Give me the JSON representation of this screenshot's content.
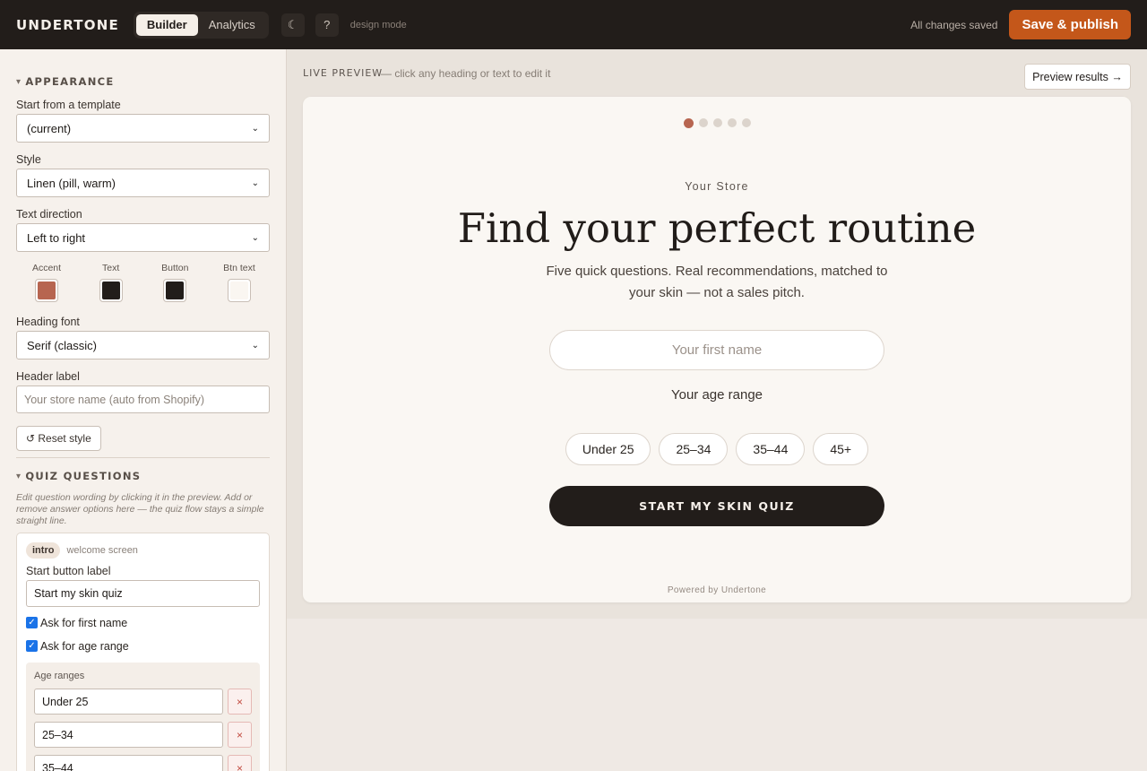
{
  "topbar": {
    "brand": "UNDERTONE",
    "tabs": [
      {
        "label": "Builder",
        "active": true
      },
      {
        "label": "Analytics",
        "active": false
      }
    ],
    "dark_mode_icon": "moon-icon",
    "help_label": "?",
    "mode_label": "design mode",
    "status": "All changes saved",
    "publish_label": "Save & publish",
    "publish_color": "#c4571a"
  },
  "sidebar": {
    "appearance": {
      "heading": "APPEARANCE",
      "template_label": "Start from a template",
      "template_value": "(current)",
      "style_label": "Style",
      "style_value": "Linen (pill, warm)",
      "direction_label": "Text direction",
      "direction_value": "Left to right",
      "swatches": [
        {
          "label": "Accent",
          "color": "#b76550"
        },
        {
          "label": "Text",
          "color": "#221d1a"
        },
        {
          "label": "Button",
          "color": "#221d1a"
        },
        {
          "label": "Btn text",
          "color": "#faf6f1"
        }
      ],
      "heading_font_label": "Heading font",
      "heading_font_value": "Serif (classic)",
      "header_label_label": "Header label",
      "header_label_placeholder": "Your store name (auto from Shopify)",
      "reset_label": "↺ Reset style"
    },
    "quiz": {
      "heading": "QUIZ QUESTIONS",
      "hint": "Edit question wording by clicking it in the preview. Add or remove answer options here — the quiz flow stays a simple straight line.",
      "intro_tag": "intro",
      "intro_desc": "welcome screen",
      "start_label_label": "Start button label",
      "start_label_value": "Start my skin quiz",
      "ask_name_label": "Ask for first name",
      "ask_name_checked": true,
      "ask_age_label": "Ask for age range",
      "ask_age_checked": true,
      "age_ranges_label": "Age ranges",
      "age_ranges": [
        "Under 25",
        "25–34",
        "35–44"
      ],
      "remove_icon": "×"
    }
  },
  "main": {
    "live_label": "LIVE PREVIEW",
    "live_hint": "— click any heading or text to edit it",
    "preview_results_label": "Preview results →",
    "preview": {
      "progress": {
        "total": 5,
        "current": 1
      },
      "store_label": "Your Store",
      "headline": "Find your perfect routine",
      "subhead": "Five quick questions. Real recommendations, matched to your skin — not a sales pitch.",
      "name_placeholder": "Your first name",
      "age_label": "Your age range",
      "age_options": [
        "Under 25",
        "25–34",
        "35–44",
        "45+"
      ],
      "cta": "START MY SKIN QUIZ",
      "powered_by": "Powered by Undertone"
    }
  }
}
